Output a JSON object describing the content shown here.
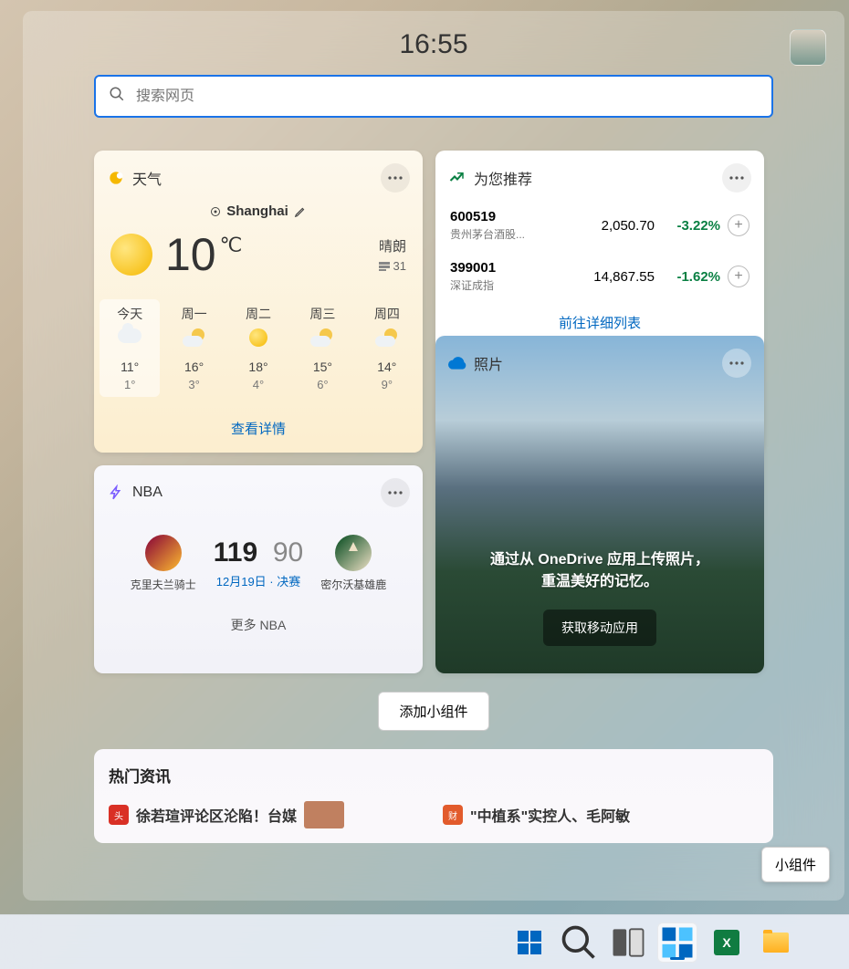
{
  "time": "16:55",
  "search": {
    "placeholder": "搜索网页"
  },
  "weather": {
    "title": "天气",
    "location": "Shanghai",
    "temp": "10",
    "unit": "℃",
    "cond": "晴朗",
    "aqi_label": "31",
    "forecast": [
      {
        "day": "今天",
        "hi": "11°",
        "lo": "1°",
        "icon": "cloud"
      },
      {
        "day": "周一",
        "hi": "16°",
        "lo": "3°",
        "icon": "suncloud"
      },
      {
        "day": "周二",
        "hi": "18°",
        "lo": "4°",
        "icon": "sun"
      },
      {
        "day": "周三",
        "hi": "15°",
        "lo": "6°",
        "icon": "suncloud"
      },
      {
        "day": "周四",
        "hi": "14°",
        "lo": "9°",
        "icon": "suncloud"
      }
    ],
    "details_link": "查看详情"
  },
  "stocks": {
    "title": "为您推荐",
    "items": [
      {
        "code": "600519",
        "name": "贵州茅台酒股...",
        "price": "2,050.70",
        "change": "-3.22%"
      },
      {
        "code": "399001",
        "name": "深证成指",
        "price": "14,867.55",
        "change": "-1.62%"
      }
    ],
    "link": "前往详细列表"
  },
  "nba": {
    "title": "NBA",
    "team1": "克里夫兰骑士",
    "team2": "密尔沃基雄鹿",
    "score1": "119",
    "score2": "90",
    "info": "12月19日 · 决赛",
    "more": "更多 NBA"
  },
  "photos": {
    "title": "照片",
    "text1": "通过从 OneDrive 应用上传照片，",
    "text2": "重温美好的记忆。",
    "button": "获取移动应用"
  },
  "add_widget": "添加小组件",
  "news": {
    "title": "热门资讯",
    "items": [
      "徐若瑄评论区沦陷！台媒",
      "\"中植系\"实控人、毛阿敏"
    ]
  },
  "float_label": "小组件"
}
